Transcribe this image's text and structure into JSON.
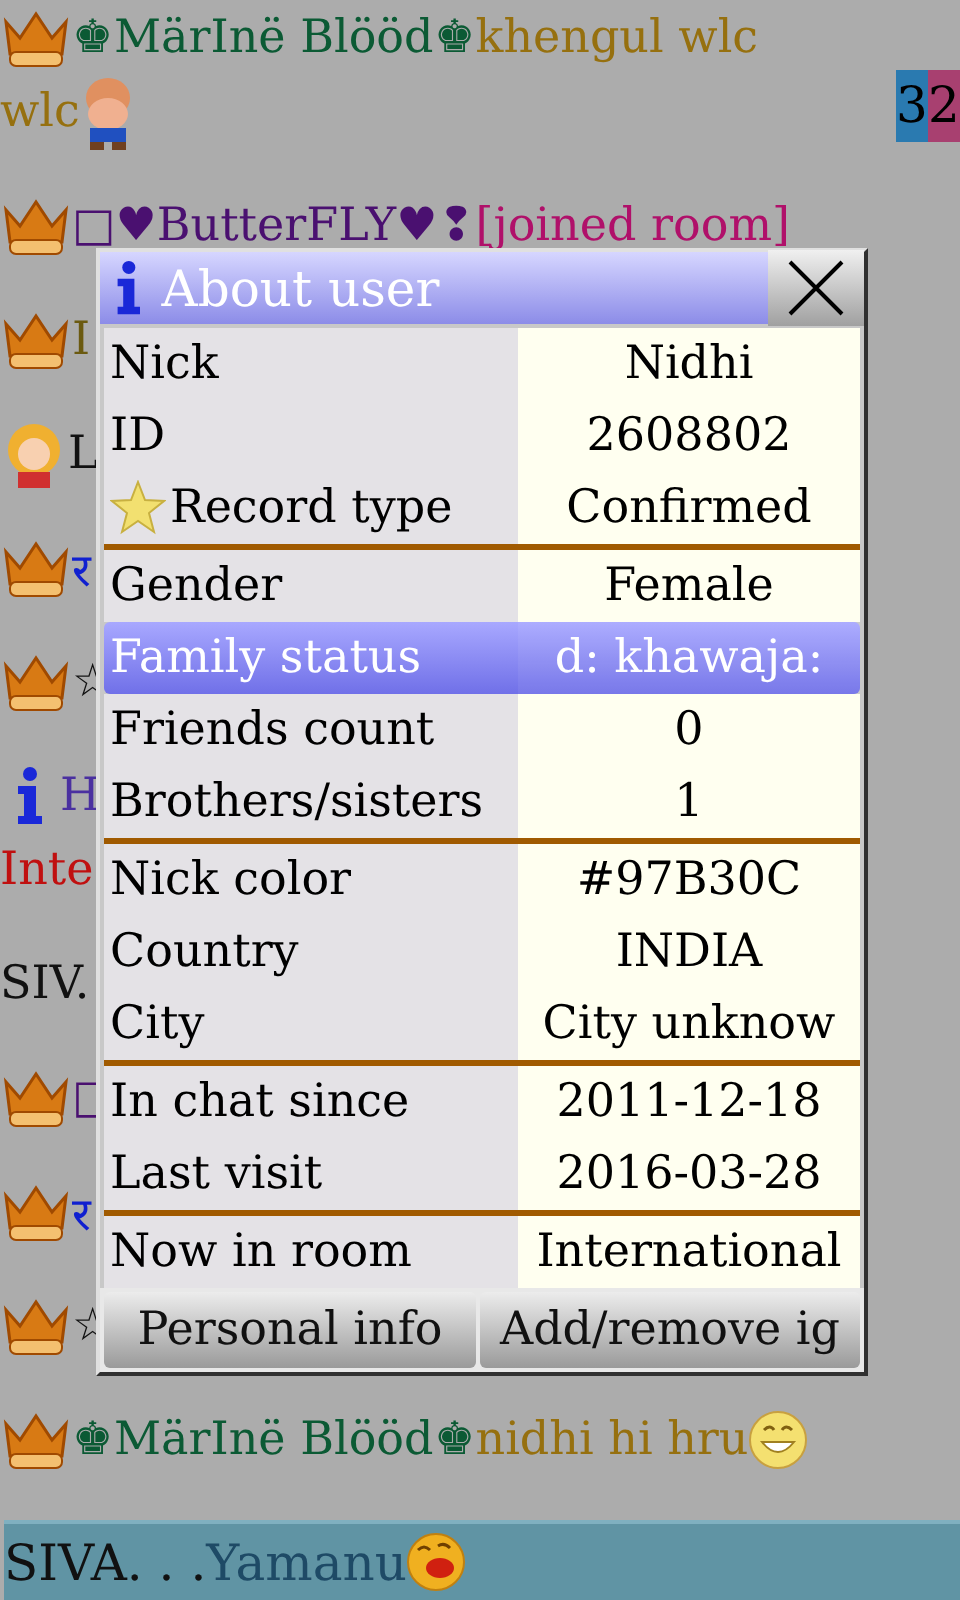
{
  "chat": [
    {
      "kind": "crown",
      "lines": [
        [
          {
            "kind": "text",
            "text": "♚MärInë Blööd♚",
            "color": "#0b5a34"
          },
          {
            "kind": "text",
            "text": "khengul wlc",
            "color": "#96700f"
          }
        ],
        [
          {
            "kind": "text",
            "text": "wlc",
            "color": "#96700f"
          },
          {
            "kind": "figure"
          }
        ]
      ]
    },
    {
      "kind": "crown",
      "lines": [
        [
          {
            "kind": "text",
            "text": "□♥ButterFLY♥❢",
            "color": "#4a1070"
          },
          {
            "kind": "text",
            "text": "[joined room]",
            "color": "#b0106a"
          }
        ]
      ]
    },
    {
      "kind": "crown",
      "lines": [
        [
          {
            "kind": "text",
            "text": "I",
            "color": "#6b5a10"
          }
        ]
      ]
    },
    {
      "kind": "avatar",
      "lines": [
        [
          {
            "kind": "text",
            "text": "L",
            "color": "#111111"
          }
        ]
      ]
    },
    {
      "kind": "crown",
      "lines": [
        [
          {
            "kind": "text",
            "text": "र",
            "color": "#1020d0"
          }
        ]
      ]
    },
    {
      "kind": "crown",
      "lines": [
        [
          {
            "kind": "text",
            "text": "☆",
            "color": "#111111"
          }
        ]
      ]
    },
    {
      "kind": "info",
      "lines": [
        [
          {
            "kind": "text",
            "text": "H",
            "color": "#4a30a0"
          }
        ],
        [
          {
            "kind": "text",
            "text": "Inte",
            "color": "#c01010"
          }
        ]
      ]
    },
    {
      "kind": "plain",
      "lines": [
        [
          {
            "kind": "text",
            "text": "SIV.",
            "color": "#111111"
          }
        ]
      ]
    },
    {
      "kind": "crown",
      "lines": [
        [
          {
            "kind": "text",
            "text": "□",
            "color": "#4a1070"
          }
        ]
      ]
    },
    {
      "kind": "crown",
      "lines": [
        [
          {
            "kind": "text",
            "text": "र",
            "color": "#1020d0"
          }
        ]
      ]
    },
    {
      "kind": "crown",
      "lines": [
        [
          {
            "kind": "text",
            "text": "☆",
            "color": "#111111"
          }
        ]
      ]
    },
    {
      "kind": "crown",
      "lines": [
        [
          {
            "kind": "text",
            "text": "♚MärInë Blööd♚",
            "color": "#0b5a34"
          },
          {
            "kind": "text",
            "text": "nidhi hi hru",
            "color": "#96700f"
          },
          {
            "kind": "grin"
          }
        ]
      ]
    }
  ],
  "counter": [
    {
      "text": "3",
      "color": "#2a7ab0"
    },
    {
      "text": "2",
      "color": "#a84070"
    }
  ],
  "dialog": {
    "title": "About user",
    "groups": [
      [
        {
          "label": "Nick",
          "value": "Nidhi",
          "kind": "plain",
          "selected": false
        },
        {
          "label": "ID",
          "value": "2608802",
          "kind": "plain",
          "selected": false
        },
        {
          "label": "Record type",
          "value": "Confirmed",
          "kind": "starred",
          "selected": false
        }
      ],
      [
        {
          "label": "Gender",
          "value": "Female",
          "kind": "plain",
          "selected": false
        },
        {
          "label": "Family status",
          "value": "d: khawaja:",
          "kind": "plain",
          "selected": true
        },
        {
          "label": "Friends count",
          "value": "0",
          "kind": "plain",
          "selected": false
        },
        {
          "label": "Brothers/sisters",
          "value": "1",
          "kind": "plain",
          "selected": false
        }
      ],
      [
        {
          "label": "Nick color",
          "value": "#97B30C",
          "kind": "plain",
          "selected": false
        },
        {
          "label": "Country",
          "value": "INDIA",
          "kind": "plain",
          "selected": false
        },
        {
          "label": "City",
          "value": "City unknow",
          "kind": "plain",
          "selected": false
        }
      ],
      [
        {
          "label": "In chat since",
          "value": "2011-12-18",
          "kind": "plain",
          "selected": false
        },
        {
          "label": "Last visit",
          "value": "2016-03-28",
          "kind": "plain",
          "selected": false
        }
      ],
      [
        {
          "label": "Now in room",
          "value": "International",
          "kind": "plain",
          "selected": false
        }
      ]
    ],
    "buttons": [
      "Personal info",
      "Add/remove ig"
    ]
  },
  "input": {
    "segments": [
      {
        "kind": "text",
        "text": "SIVA. . .",
        "color": "#111111"
      },
      {
        "kind": "text",
        "text": "Yamanu",
        "color": "#1e4a66"
      },
      {
        "kind": "laugh"
      }
    ]
  }
}
